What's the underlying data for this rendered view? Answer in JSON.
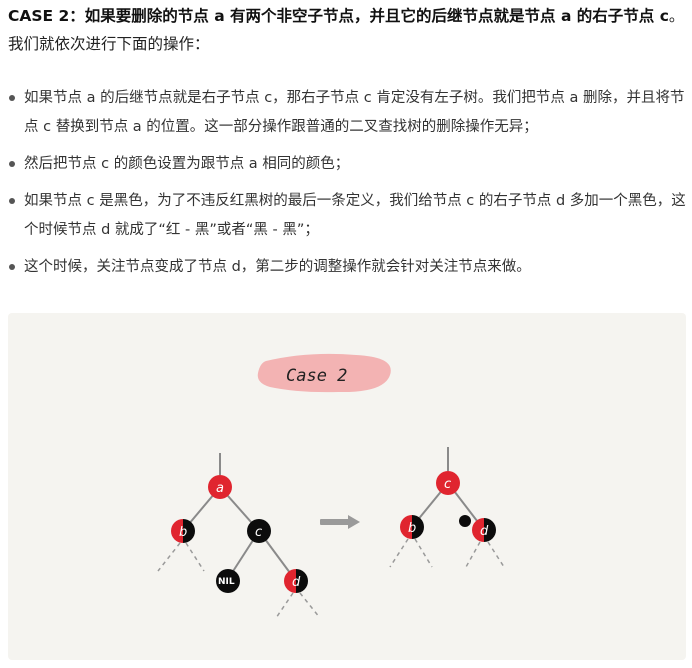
{
  "heading": {
    "case_label": "CASE 2：如果要删除的节点 a 有两个非空子节点，并且它的后继节点就是节点 a 的右子节点 c",
    "tail": "。我们就依次进行下面的操作："
  },
  "bullets": [
    "如果节点 a 的后继节点就是右子节点 c，那右子节点 c 肯定没有左子树。我们把节点 a 删除，并且将节点 c 替换到节点 a 的位置。这一部分操作跟普通的二叉查找树的删除操作无异；",
    "然后把节点 c 的颜色设置为跟节点 a 相同的颜色；",
    "如果节点 c 是黑色，为了不违反红黑树的最后一条定义，我们给节点 c 的右子节点 d 多加一个黑色，这个时候节点 d 就成了“红 - 黑”或者“黑 - 黑”；",
    "这个时候，关注节点变成了节点 d，第二步的调整操作就会针对关注节点来做。"
  ],
  "figure": {
    "title": "Case 2",
    "colors": {
      "red": "#e0252f",
      "black": "#0c0c0c",
      "line": "#888888",
      "arrow": "#9a9a9a",
      "highlight": "#f2a7a8"
    },
    "before_tree": {
      "nodes": [
        {
          "id": "a",
          "label": "a",
          "color": "red"
        },
        {
          "id": "b",
          "label": "b",
          "color": "red-black"
        },
        {
          "id": "c",
          "label": "c",
          "color": "black"
        },
        {
          "id": "nil",
          "label": "NIL",
          "color": "black"
        },
        {
          "id": "d",
          "label": "d",
          "color": "red-black"
        }
      ]
    },
    "after_tree": {
      "nodes": [
        {
          "id": "c",
          "label": "c",
          "color": "red"
        },
        {
          "id": "b",
          "label": "b",
          "color": "red-black"
        },
        {
          "id": "d",
          "label": "d",
          "color": "red-black",
          "extra_black": true
        }
      ]
    }
  }
}
